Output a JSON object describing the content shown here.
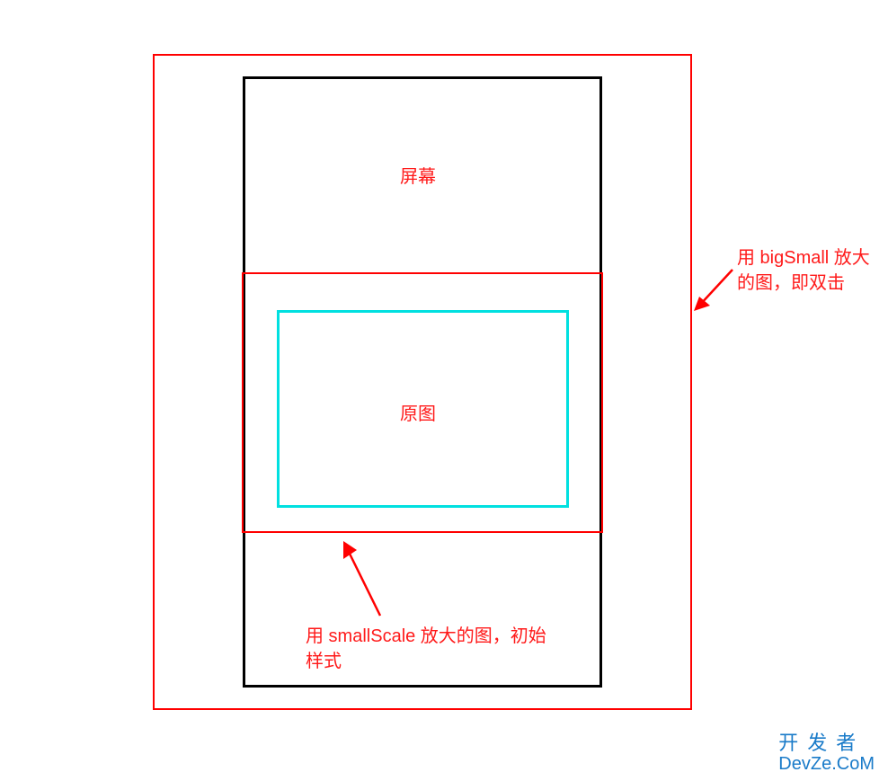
{
  "labels": {
    "screen": "屏幕",
    "original": "原图"
  },
  "annotations": {
    "right": "用 bigSmall 放大的图，即双击",
    "bottom": "用 smallScale 放大的图，初始样式"
  },
  "watermark": {
    "line1": "开发者",
    "line2": "DevZe.CoM"
  },
  "colors": {
    "red": "#ff0000",
    "cyan": "#00e0e0",
    "black": "#000000",
    "brand": "#1a7bc9"
  }
}
